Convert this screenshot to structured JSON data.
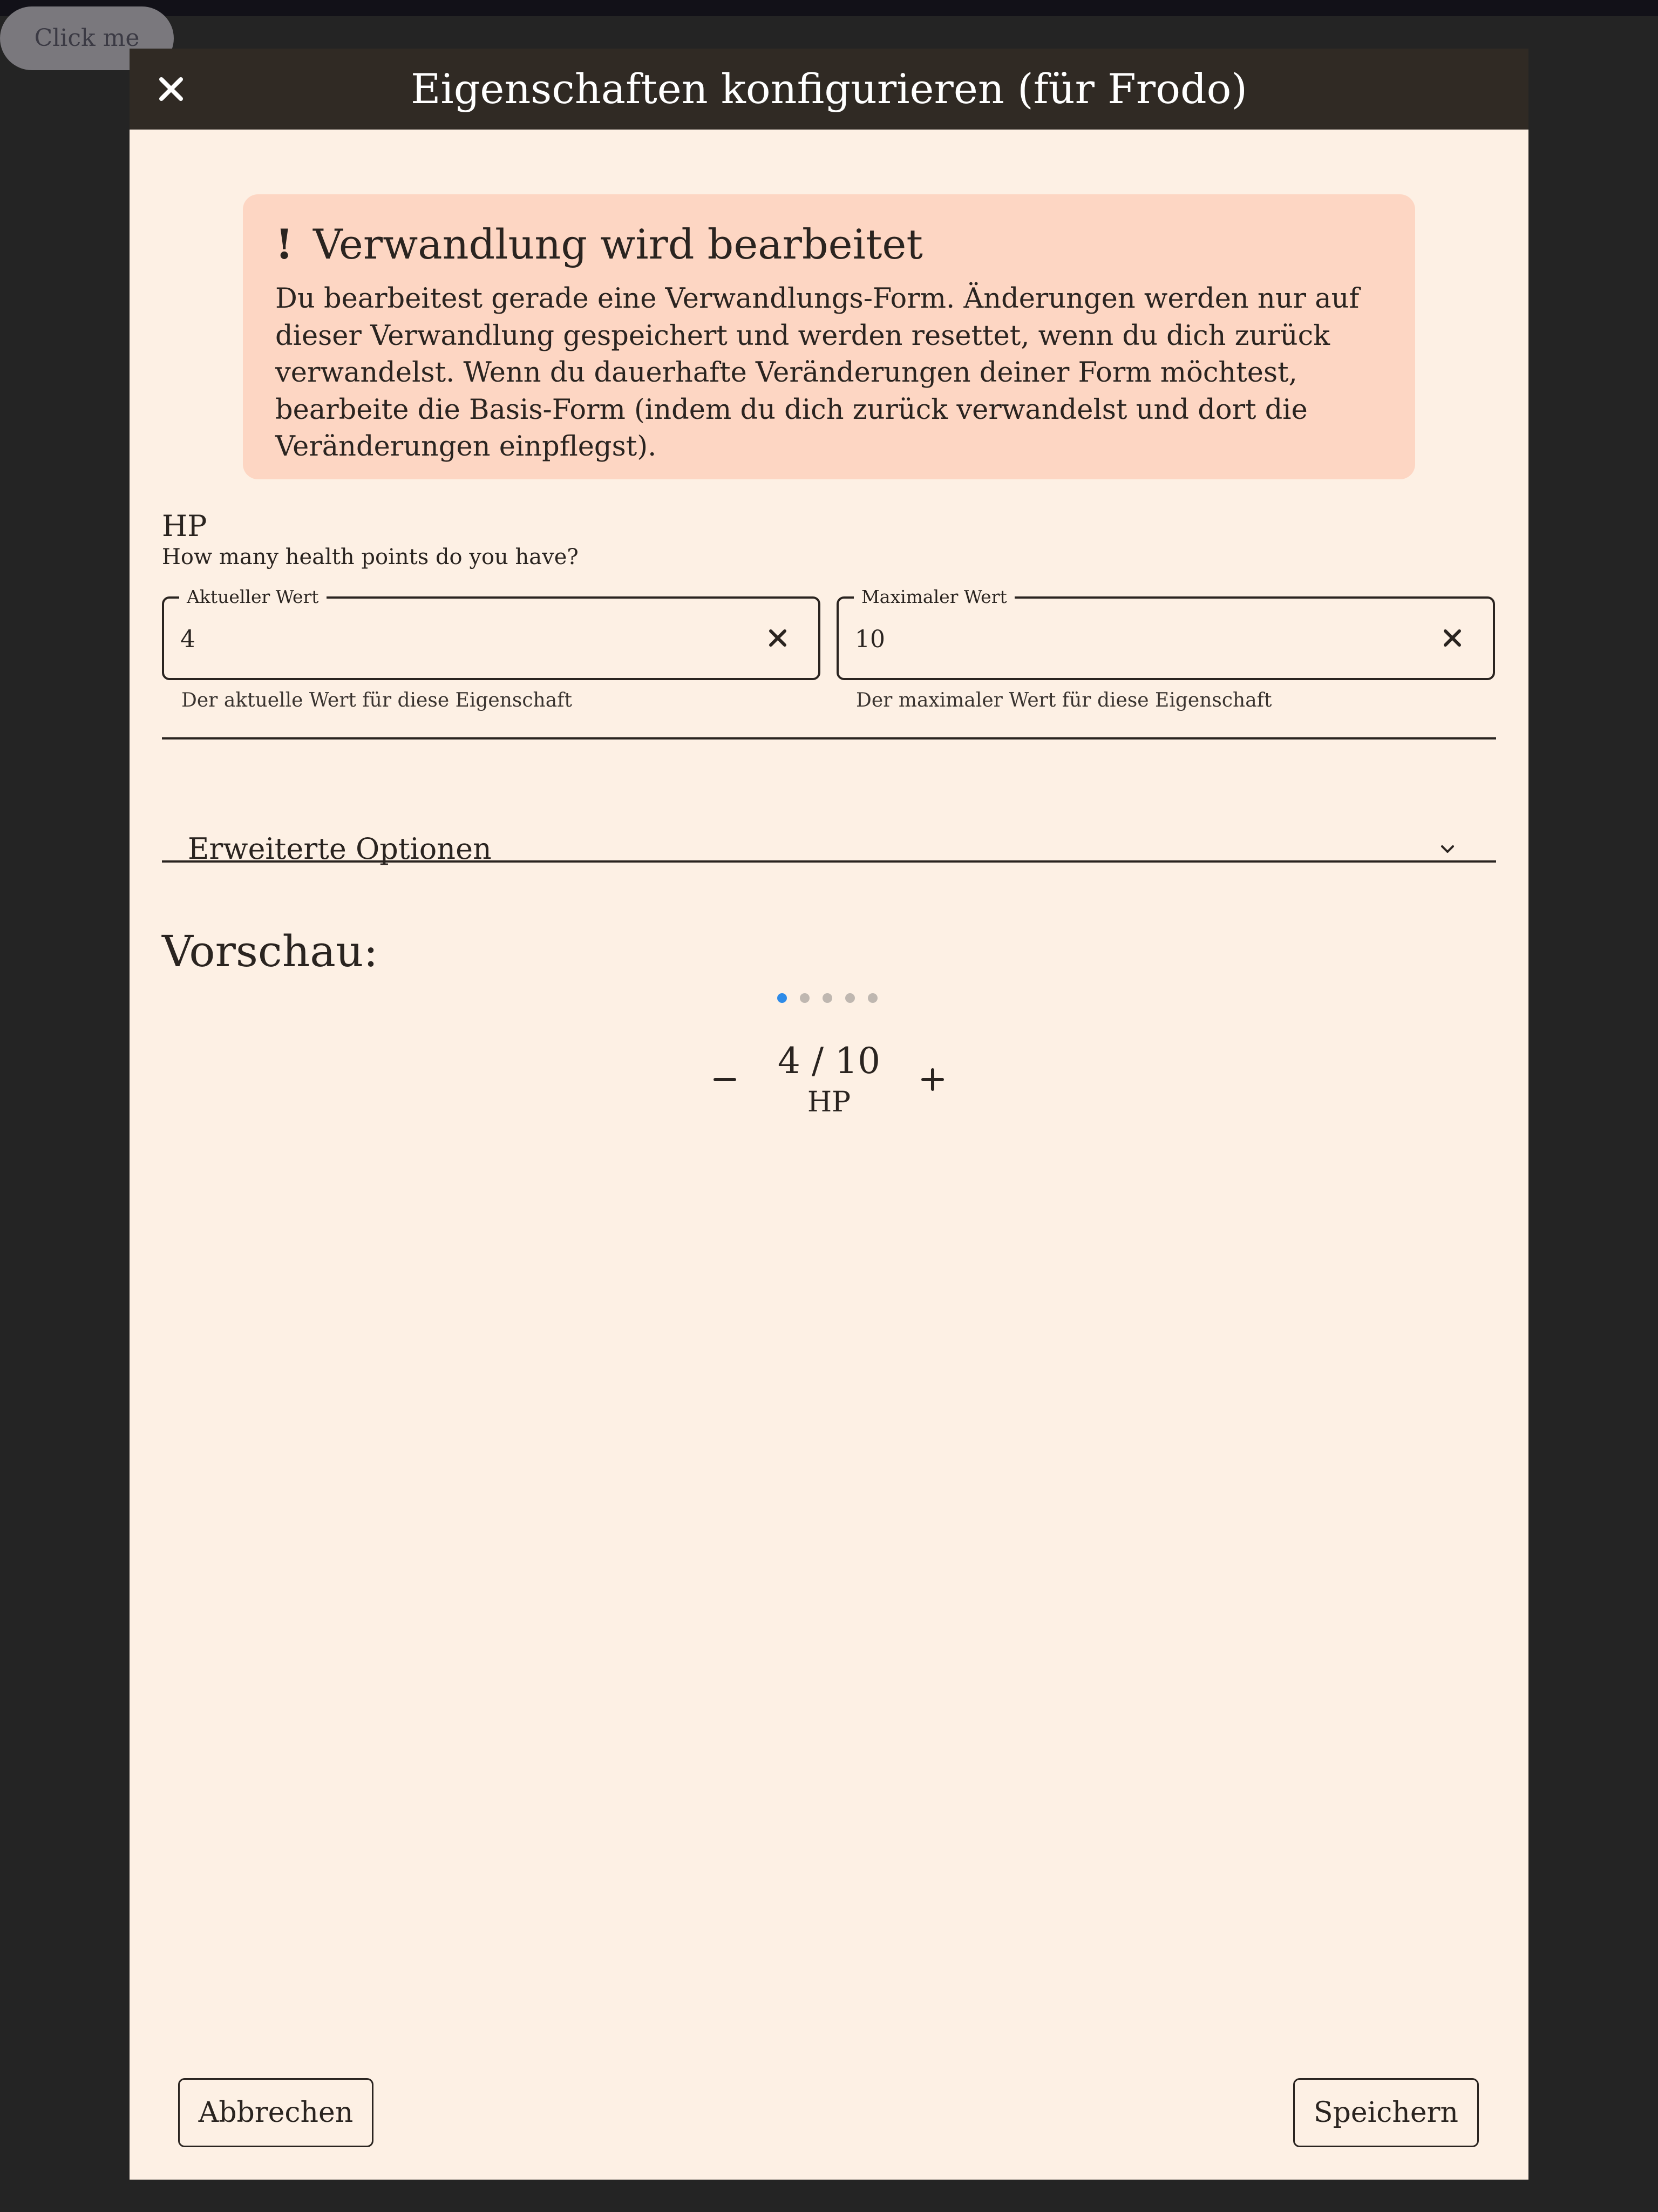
{
  "background_button": {
    "label": "Click me"
  },
  "dialog": {
    "title": "Eigenschaften konfigurieren (für Frodo)",
    "close_icon": "close-icon"
  },
  "warning": {
    "icon": "!",
    "title": "Verwandlung wird bearbeitet",
    "text": "Du bearbeitest gerade eine Verwandlungs-Form. Änderungen werden nur auf dieser Verwandlung gespeichert und werden resettet, wenn du dich zurück verwandelst. Wenn du dauerhafte Veränderungen deiner Form möchtest, bearbeite die Basis-Form (indem du dich zurück verwandelst und dort die Veränderungen einpflegst).",
    "background_color": "#fdd6c3"
  },
  "property": {
    "name": "HP",
    "description": "How many health points do you have?"
  },
  "fields": {
    "current": {
      "label": "Aktueller Wert",
      "value": "4",
      "helper": "Der aktuelle Wert für diese Eigenschaft"
    },
    "max": {
      "label": "Maximaler Wert",
      "value": "10",
      "helper": "Der maximaler Wert für diese Eigenschaft"
    }
  },
  "advanced": {
    "label": "Erweiterte Optionen",
    "expanded": false
  },
  "preview": {
    "heading": "Vorschau:",
    "page_count": 5,
    "active_page": 1,
    "active_dot_color": "#2e8be8",
    "display_value": "4 / 10",
    "unit": "HP",
    "decrement_label": "−",
    "increment_label": "+"
  },
  "footer": {
    "cancel_label": "Abbrechen",
    "save_label": "Speichern"
  },
  "colors": {
    "page_background": "#242424",
    "dialog_background": "#fdf0e4",
    "header_background": "#302a24"
  }
}
